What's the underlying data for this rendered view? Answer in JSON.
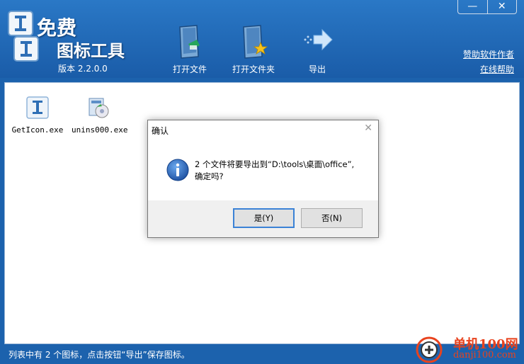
{
  "app": {
    "title_line1": "免费",
    "title_line2": "图标工具",
    "version": "版本 2.2.0.0"
  },
  "toolbar": {
    "open_file": "打开文件",
    "open_folder": "打开文件夹",
    "export": "导出"
  },
  "links": {
    "sponsor": "赞助软件作者",
    "help": "在线帮助"
  },
  "window_controls": {
    "minimize": "—",
    "close": "✕"
  },
  "files": [
    {
      "name": "GetIcon.exe",
      "icon": "app-icon-getitem"
    },
    {
      "name": "unins000.exe",
      "icon": "uninstaller-icon"
    }
  ],
  "status": {
    "text": "列表中有 2 个图标，点击按钮“导出”保存图标。"
  },
  "dialog": {
    "title": "确认",
    "close": "✕",
    "message_line1": "2 个文件将要导出到“D:\\tools\\桌面\\office”,",
    "message_line2": "确定吗?",
    "yes": "是(Y)",
    "no": "否(N)"
  },
  "watermark": {
    "line1": "单机100网",
    "line2": "danji100.com"
  },
  "colors": {
    "header_blue": "#1c62ad",
    "accent": "#3b82d6",
    "watermark": "#e8431e"
  }
}
